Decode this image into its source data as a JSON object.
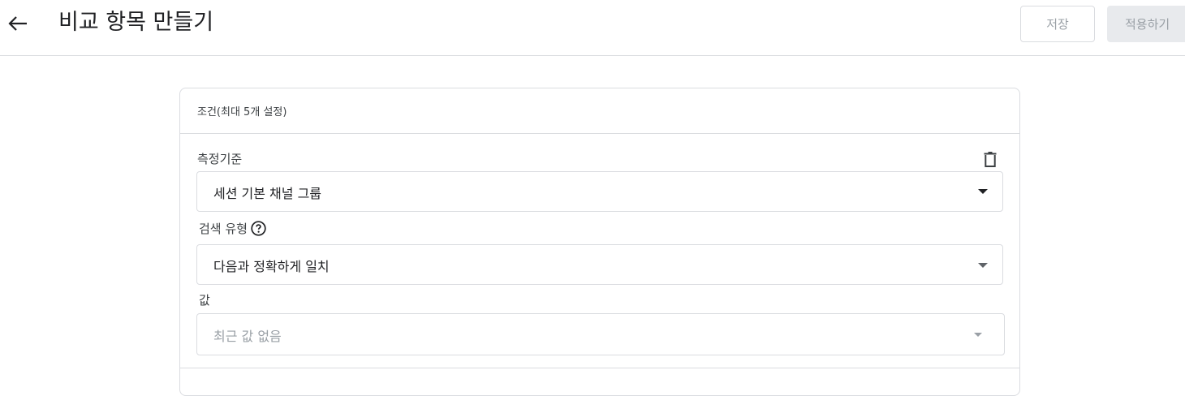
{
  "header": {
    "back_icon": "arrow-left-icon",
    "title": "비교 항목 만들기",
    "save_label": "저장",
    "apply_label": "적용하기"
  },
  "card": {
    "header_text": "조건(최대 5개 설정)",
    "dimension": {
      "label": "측정기준",
      "value": "세션 기본 채널 그룹",
      "delete_icon": "trash-icon"
    },
    "match_type": {
      "label": "검색 유형",
      "help_icon": "help-circle-icon",
      "value": "다음과 정확하게 일치"
    },
    "value_field": {
      "label": "값",
      "placeholder": "최근 값 없음"
    }
  }
}
